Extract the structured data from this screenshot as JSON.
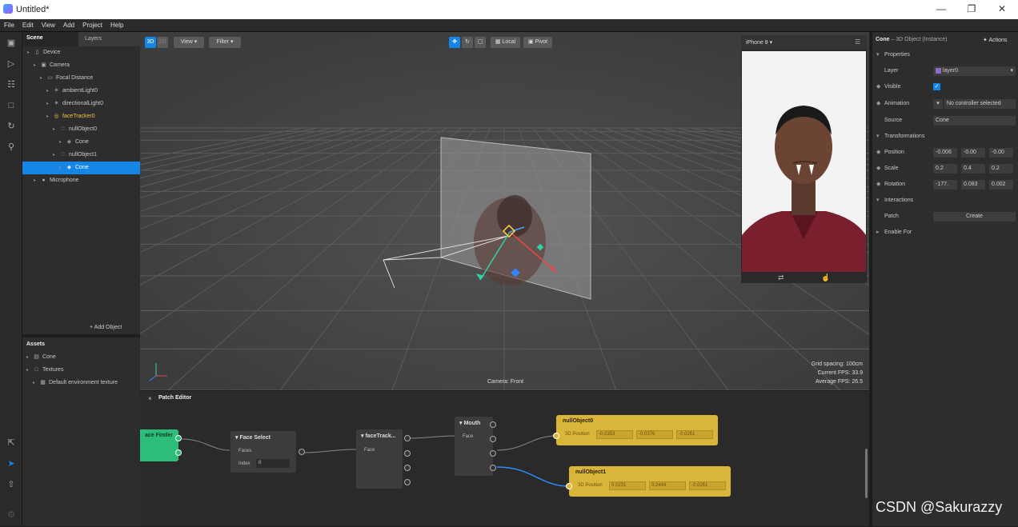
{
  "window": {
    "title": "Untitled*"
  },
  "menu": [
    "File",
    "Edit",
    "View",
    "Add",
    "Project",
    "Help"
  ],
  "scene_panel": {
    "tabs": [
      "Scene",
      "Layers"
    ],
    "tree": [
      {
        "label": "Device",
        "icon": "device-icon",
        "depth": 0
      },
      {
        "label": "Camera",
        "icon": "camera-icon",
        "depth": 1
      },
      {
        "label": "Focal Distance",
        "icon": "focal-icon",
        "depth": 2
      },
      {
        "label": "ambientLight0",
        "icon": "light-icon",
        "depth": 3
      },
      {
        "label": "directionalLight0",
        "icon": "directional-light-icon",
        "depth": 3
      },
      {
        "label": "faceTracker0",
        "icon": "face-tracker-icon",
        "depth": 3,
        "highlight": true
      },
      {
        "label": "nullObject0",
        "icon": "null-object-icon",
        "depth": 4
      },
      {
        "label": "Cone",
        "icon": "cube-icon",
        "depth": 5
      },
      {
        "label": "nullObject1",
        "icon": "null-object-icon",
        "depth": 4
      },
      {
        "label": "Cone",
        "icon": "cube-icon",
        "depth": 5,
        "selected": true
      },
      {
        "label": "Microphone",
        "icon": "microphone-icon",
        "depth": 1
      }
    ],
    "add_object": "+ Add Object"
  },
  "assets": {
    "title": "Assets",
    "items": [
      {
        "label": "Cone",
        "icon": "file-icon",
        "depth": 0
      },
      {
        "label": "Textures",
        "icon": "folder-icon",
        "depth": 0
      },
      {
        "label": "Default environment texture",
        "icon": "texture-icon",
        "depth": 1
      }
    ]
  },
  "viewport": {
    "buttons": {
      "mode3d": "3D",
      "mode2d": "2D",
      "view": "View",
      "filter": "Filter",
      "local": "Local",
      "pivot": "Pivot"
    },
    "info": {
      "grid": "Grid spacing: 100cm",
      "fps": "Current FPS: 33.9",
      "avg": "Average FPS: 26.5"
    },
    "camera_label": "Camera: Front",
    "device": "iPhone 8"
  },
  "patch_editor": {
    "title": "Patch Editor",
    "nodes": {
      "face_finder": "ace Finder",
      "face_select": {
        "title": "Face Select",
        "ports": [
          "Faces",
          "Index"
        ],
        "index_value": "0"
      },
      "face_tracker": {
        "title": "faceTrack...",
        "ports": [
          "Face"
        ]
      },
      "mouth": {
        "title": "Mouth",
        "ports": [
          "Face"
        ]
      },
      "null0": {
        "title": "nullObject0",
        "port": "3D Position",
        "values": [
          "-0.0353",
          "-0.0376",
          "-0.0261"
        ]
      },
      "null1": {
        "title": "nullObject1",
        "port": "3D Position",
        "values": [
          "0.0231",
          "0.0444",
          "-0.0261"
        ]
      }
    }
  },
  "inspector": {
    "header": {
      "name": "Cone",
      "type": "– 3D Object (Instance)",
      "actions": "Actions"
    },
    "sections": {
      "properties": "Properties",
      "transformations": "Transformations",
      "interactions": "Interactions",
      "enable_for": "Enable For"
    },
    "layer": {
      "label": "Layer",
      "value": "layer0"
    },
    "visible": {
      "label": "Visible"
    },
    "animation": {
      "label": "Animation",
      "value": "No controller selected"
    },
    "source": {
      "label": "Source",
      "value": "Cone"
    },
    "position": {
      "label": "Position",
      "values": [
        "-0.006",
        "-0.00",
        "-0.00"
      ]
    },
    "scale": {
      "label": "Scale",
      "values": [
        "0.2",
        "0.4",
        "0.2"
      ]
    },
    "rotation": {
      "label": "Rotation",
      "values": [
        "-177.",
        "0.083",
        "0.002"
      ]
    },
    "patch": {
      "label": "Patch",
      "button": "Create"
    }
  },
  "watermark": "CSDN @Sakurazzy",
  "colors": {
    "accent": "#1686e6",
    "patch_yellow": "#d9b53a",
    "face_finder_green": "#2dbd7a",
    "tracker_yellow": "#e8c547"
  }
}
